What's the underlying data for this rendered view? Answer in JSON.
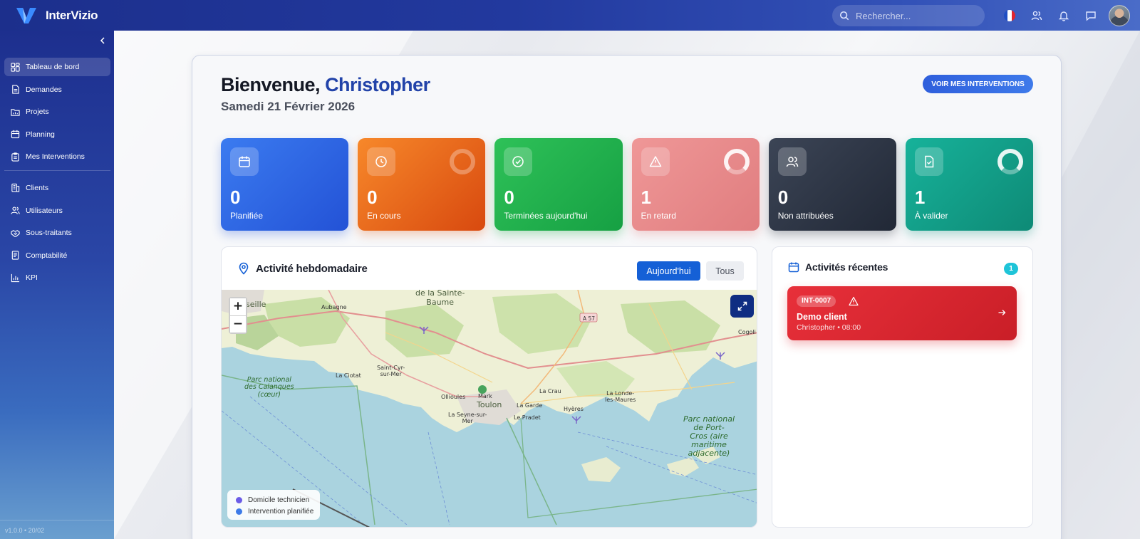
{
  "app": {
    "name": "InterVizio",
    "version": "v1.0.0 • 20/02"
  },
  "search": {
    "placeholder": "Rechercher..."
  },
  "topbar_icons": [
    "flag-fr-icon",
    "users-icon",
    "bell-icon",
    "chat-icon",
    "avatar"
  ],
  "sidebar": {
    "items": [
      {
        "label": "Tableau de bord",
        "icon": "dashboard-icon",
        "active": true
      },
      {
        "label": "Demandes",
        "icon": "file-icon"
      },
      {
        "label": "Projets",
        "icon": "folder-icon"
      },
      {
        "label": "Planning",
        "icon": "calendar-icon"
      },
      {
        "label": "Mes Interventions",
        "icon": "clipboard-icon"
      },
      {
        "label": "Clients",
        "icon": "building-icon"
      },
      {
        "label": "Utilisateurs",
        "icon": "users-icon"
      },
      {
        "label": "Sous-traitants",
        "icon": "handshake-icon"
      },
      {
        "label": "Comptabilité",
        "icon": "receipt-icon"
      },
      {
        "label": "KPI",
        "icon": "bar-chart-icon"
      }
    ]
  },
  "header": {
    "greeting": "Bienvenue,",
    "name": "Christopher",
    "date": "Samedi 21 Février 2026",
    "cta_label": "VOIR MES INTERVENTIONS"
  },
  "stats": [
    {
      "value": "0",
      "label": "Planifiée",
      "icon": "calendar-icon",
      "color": "#2f66e4"
    },
    {
      "value": "0",
      "label": "En cours",
      "icon": "clock-icon",
      "color": "#ee6a1e"
    },
    {
      "value": "0",
      "label": "Terminées aujourd'hui",
      "icon": "check-circle-icon",
      "color": "#22b24e"
    },
    {
      "value": "1",
      "label": "En retard",
      "icon": "warning-icon",
      "color": "#e88a8b"
    },
    {
      "value": "0",
      "label": "Non attribuées",
      "icon": "users-icon",
      "color": "#2e3646"
    },
    {
      "value": "1",
      "label": "À valider",
      "icon": "file-check-icon",
      "color": "#139e88"
    }
  ],
  "map_section": {
    "title": "Activité hebdomadaire",
    "filter_today": "Aujourd'hui",
    "filter_all": "Tous",
    "zoom_in": "+",
    "zoom_out": "−",
    "legend": [
      {
        "label": "Domicile technicien",
        "color": "#6b5ce7"
      },
      {
        "label": "Intervention planifiée",
        "color": "#3d7be8"
      }
    ],
    "place_labels": {
      "sainte_baume": "de la Sainte-\nBaume",
      "seille": "seille",
      "aubagne": "Aubagne",
      "a57": "A 57",
      "cogolin": "Cogoli",
      "la_ciotat": "La Ciotat",
      "saint_cyr": "Saint-Cyr-\nsur-Mer",
      "calanques": "Parc national\ndes Calanques\n(cœur)",
      "ollioules": "Ollioules",
      "toulon": "Toulon",
      "marker": "Mark",
      "la_crau": "La Crau",
      "la_londe": "La Londe-\nles-Maures",
      "la_garde": "La Garde",
      "la_seyne": "La Seyne-sur-\nMer",
      "le_pradet": "Le Pradet",
      "hyeres": "Hyères",
      "port_cros": "Parc national\nde Port-\nCros (aire\nmaritime\nadjacente)"
    }
  },
  "activities": {
    "title": "Activités récentes",
    "count": "1",
    "items": [
      {
        "ref": "INT-0007",
        "client": "Demo client",
        "meta": "Christopher • 08:00"
      }
    ]
  }
}
